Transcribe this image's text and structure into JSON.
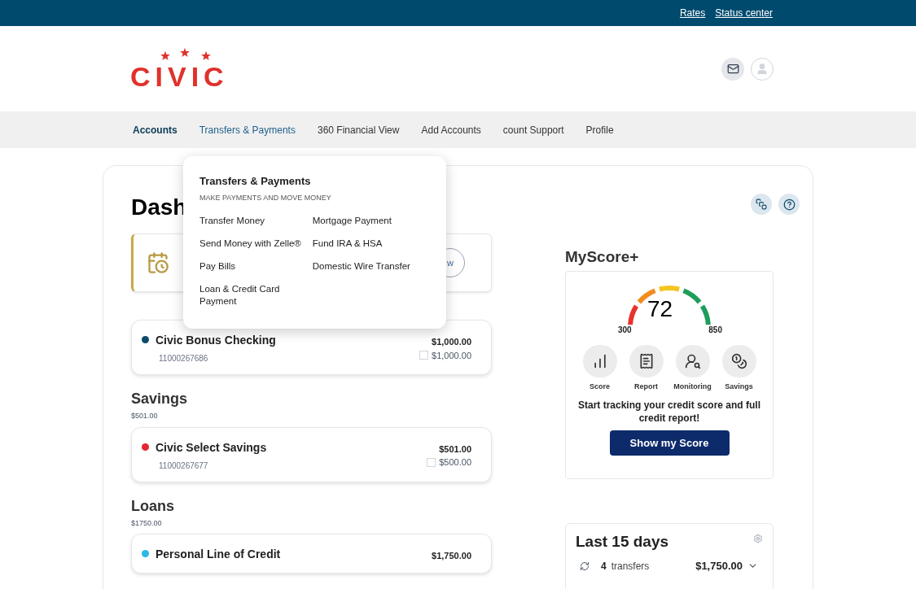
{
  "top_links": [
    "Rates",
    "Status center"
  ],
  "logo": "CIVIC",
  "nav": [
    {
      "label": "Accounts",
      "selected": true,
      "expanded": false
    },
    {
      "label": "Transfers & Payments",
      "selected": false,
      "expanded": true
    },
    {
      "label": "360 Financial View",
      "selected": false,
      "expanded": false
    },
    {
      "label": "Add Accounts",
      "selected": false,
      "expanded": false
    },
    {
      "label": "count Support",
      "selected": false,
      "expanded": false
    },
    {
      "label": "Profile",
      "selected": false,
      "expanded": false
    }
  ],
  "dropdown": {
    "title": "Transfers & Payments",
    "subtitle": "MAKE PAYMENTS AND MOVE MONEY",
    "columns": [
      [
        "Transfer Money",
        "Send Money with Zelle®",
        "Pay Bills",
        "Loan & Credit Card Payment"
      ],
      [
        "Mortgage Payment",
        "Fund IRA & HSA",
        "Domestic Wire Transfer"
      ]
    ]
  },
  "dashboard": {
    "title": "Dash"
  },
  "banner": {
    "button": "w"
  },
  "sections": [
    {
      "accounts": [
        {
          "name": "Civic Bonus Checking",
          "number": "11000267686",
          "balance": "$1,000.00",
          "available": "$1,000.00",
          "color": "#0b4a6b"
        }
      ]
    },
    {
      "heading": "Savings",
      "total": "$501.00",
      "accounts": [
        {
          "name": "Civic Select Savings",
          "number": "11000267677",
          "balance": "$501.00",
          "available": "$500.00",
          "color": "#e52630"
        }
      ]
    },
    {
      "heading": "Loans",
      "total": "$1750.00",
      "accounts": [
        {
          "name": "Personal Line of Credit",
          "balance": "$1,750.00",
          "color": "#2bb8e8"
        }
      ]
    }
  ],
  "myscore": {
    "title": "MyScore+",
    "score": "72",
    "min": "300",
    "max": "850",
    "features": [
      {
        "kind": "score",
        "label": "Score"
      },
      {
        "kind": "report",
        "label": "Report"
      },
      {
        "kind": "monitoring",
        "label": "Monitoring"
      },
      {
        "kind": "savings",
        "label": "Savings"
      }
    ],
    "text": "Start tracking your credit score and full credit report!",
    "button": "Show my Score"
  },
  "last15": {
    "title": "Last 15 days",
    "count": "4",
    "label": "transfers",
    "amount": "$1,750.00"
  }
}
